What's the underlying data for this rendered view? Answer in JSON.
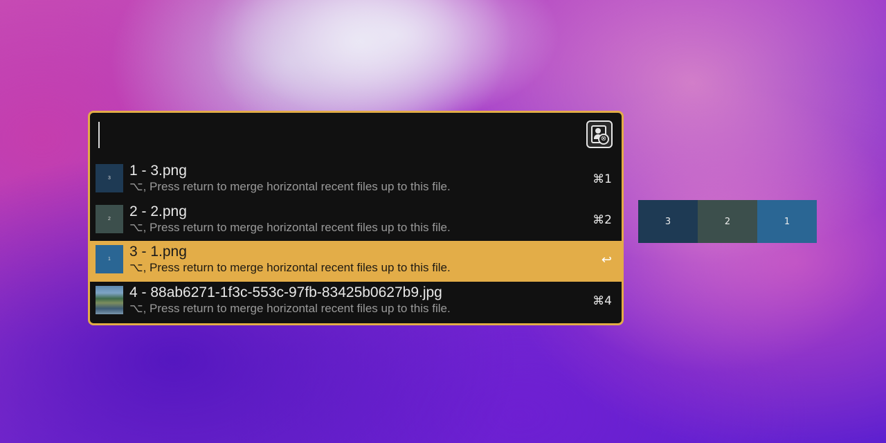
{
  "panel": {
    "app_icon": "image-merge-app-icon",
    "caret_visible": true
  },
  "results": [
    {
      "title": "1 - 3.png",
      "subtitle": "⌥, Press return to merge horizontal recent files up to this file.",
      "shortcut": "⌘1",
      "thumb_label": "3",
      "thumb_color": "#1e3a54",
      "selected": false
    },
    {
      "title": "2 - 2.png",
      "subtitle": "⌥, Press return to merge horizontal recent files up to this file.",
      "shortcut": "⌘2",
      "thumb_label": "2",
      "thumb_color": "#3c4f4c",
      "selected": false
    },
    {
      "title": "3 - 1.png",
      "subtitle": "⌥, Press return to merge horizontal recent files up to this file.",
      "shortcut": "↩",
      "thumb_label": "1",
      "thumb_color": "#2a6694",
      "selected": true
    },
    {
      "title": "4 - 88ab6271-1f3c-553c-97fb-83425b0627b9.jpg",
      "subtitle": "⌥, Press return to merge horizontal recent files up to this file.",
      "shortcut": "⌘4",
      "thumb_label": "",
      "thumb_color": "photo",
      "selected": false
    }
  ],
  "preview": {
    "tiles": [
      {
        "label": "3",
        "color": "#1e3a54"
      },
      {
        "label": "2",
        "color": "#3c4f4c"
      },
      {
        "label": "1",
        "color": "#2a6694"
      }
    ]
  },
  "colors": {
    "accent": "#e2ac48",
    "panel_bg": "#111111",
    "selected_row": "#e3ad48"
  }
}
